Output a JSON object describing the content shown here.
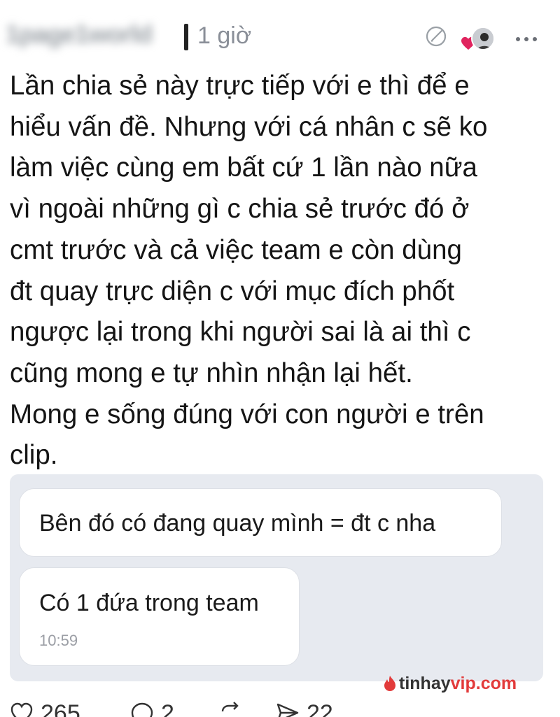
{
  "header": {
    "username": "1page1world",
    "time": "1 giờ"
  },
  "post": {
    "lines": [
      "Lần chia sẻ này trực tiếp với e thì để e",
      "hiểu vấn đề. Nhưng với cá nhân c sẽ ko",
      "làm việc cùng em bất cứ 1 lần nào nữa",
      "vì ngoài những gì c chia sẻ trước đó ở",
      "cmt trước và cả việc team e còn dùng",
      "đt quay trực diện c với mục đích phốt",
      "ngược lại trong khi người sai là ai thì c",
      "cũng mong e tự nhìn nhận lại hết.",
      "Mong e sống đúng với con người e trên",
      "clip."
    ]
  },
  "chat": {
    "message_1": "Bên đó có đang quay mình = đt c nha",
    "message_2": "Có 1 đứa trong team",
    "message_2_time": "10:59"
  },
  "watermark": {
    "part_a": "tinhay",
    "part_b": "vip.com"
  },
  "actions": {
    "likes": "265",
    "replies": "2",
    "shares": "22"
  },
  "colors": {
    "accent_red": "#e23b3b",
    "card_bg": "#e7eaf0"
  }
}
